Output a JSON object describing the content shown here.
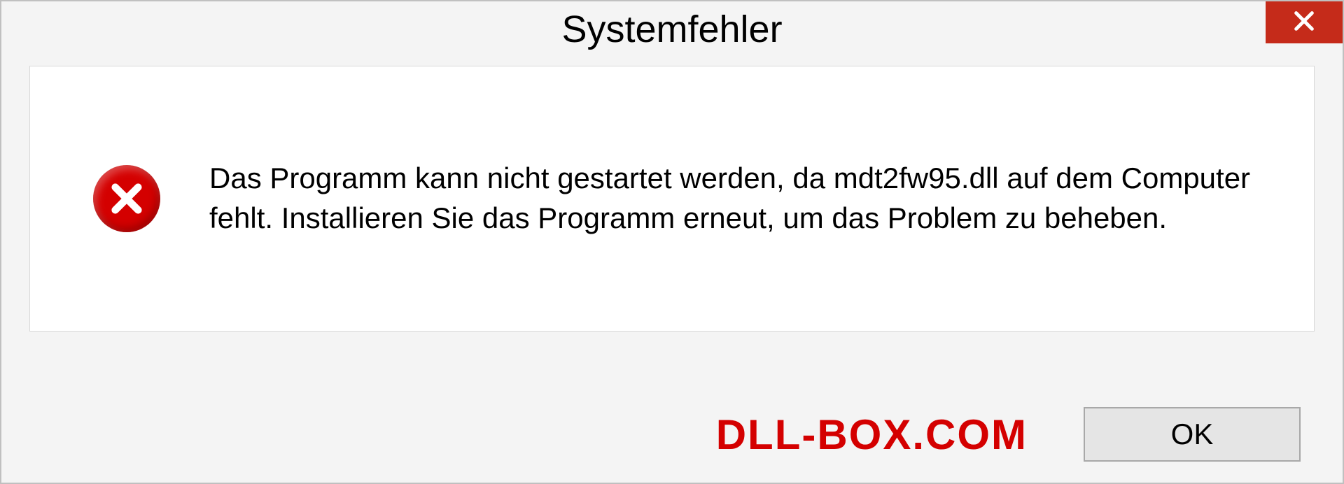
{
  "window": {
    "title": "Systemfehler"
  },
  "message": {
    "text": "Das Programm kann nicht gestartet werden, da mdt2fw95.dll auf dem Computer fehlt. Installieren Sie das Programm erneut, um das Problem zu beheben."
  },
  "watermark": {
    "text": "DLL-BOX.COM"
  },
  "buttons": {
    "ok_label": "OK"
  }
}
